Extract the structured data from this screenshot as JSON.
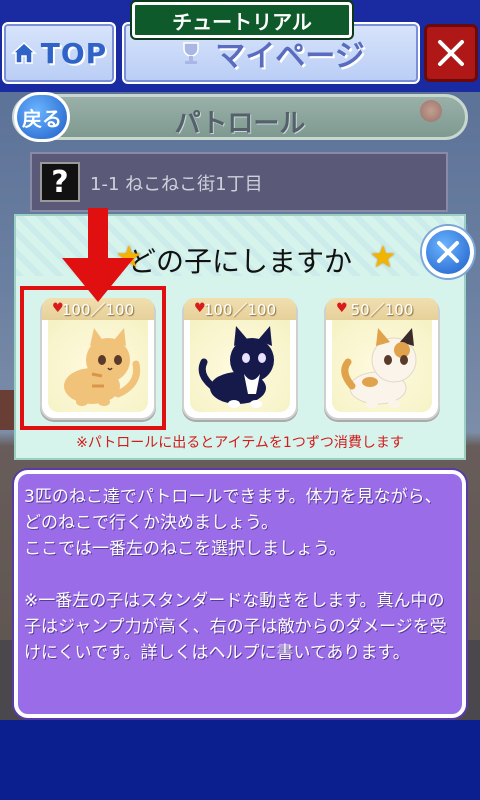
{
  "header": {
    "tutorial_label": "チュートリアル",
    "top_label": "TOP",
    "mypage_label": "マイページ",
    "close_label": "✕"
  },
  "title_bar": {
    "back_label": "戻る",
    "title": "パトロール"
  },
  "stage": {
    "badge": "?",
    "name": "1-1 ねこねこ街1丁目"
  },
  "select_panel": {
    "title": "どの子にしますか",
    "note": "※パトロールに出るとアイテムを1つずつ消費します",
    "cats": [
      {
        "hp": "100／100",
        "fur": "#f1c27a",
        "accent": "#d9954a"
      },
      {
        "hp": "100／100",
        "fur": "#151a4a",
        "accent": "#ffffff"
      },
      {
        "hp": "50／100",
        "fur": "#fbf4ea",
        "accent": "#e0a24a"
      }
    ]
  },
  "message": {
    "line1": "3匹のねこ達でパトロールできます。体力を見ながら、どのねこで行くか決めましょう。",
    "line2": "ここでは一番左のねこを選択しましょう。",
    "line3": "※一番左の子はスタンダードな動きをします。真ん中の子はジャンプ力が高く、右の子は敵からのダメージを受けにくいです。詳しくはヘルプに書いてあります。"
  },
  "colors": {
    "accent_red": "#e01010",
    "message_bg": "#9a6ce8",
    "panel_bg": "#d6f3ec",
    "frame_blue": "#0b1f8f"
  }
}
